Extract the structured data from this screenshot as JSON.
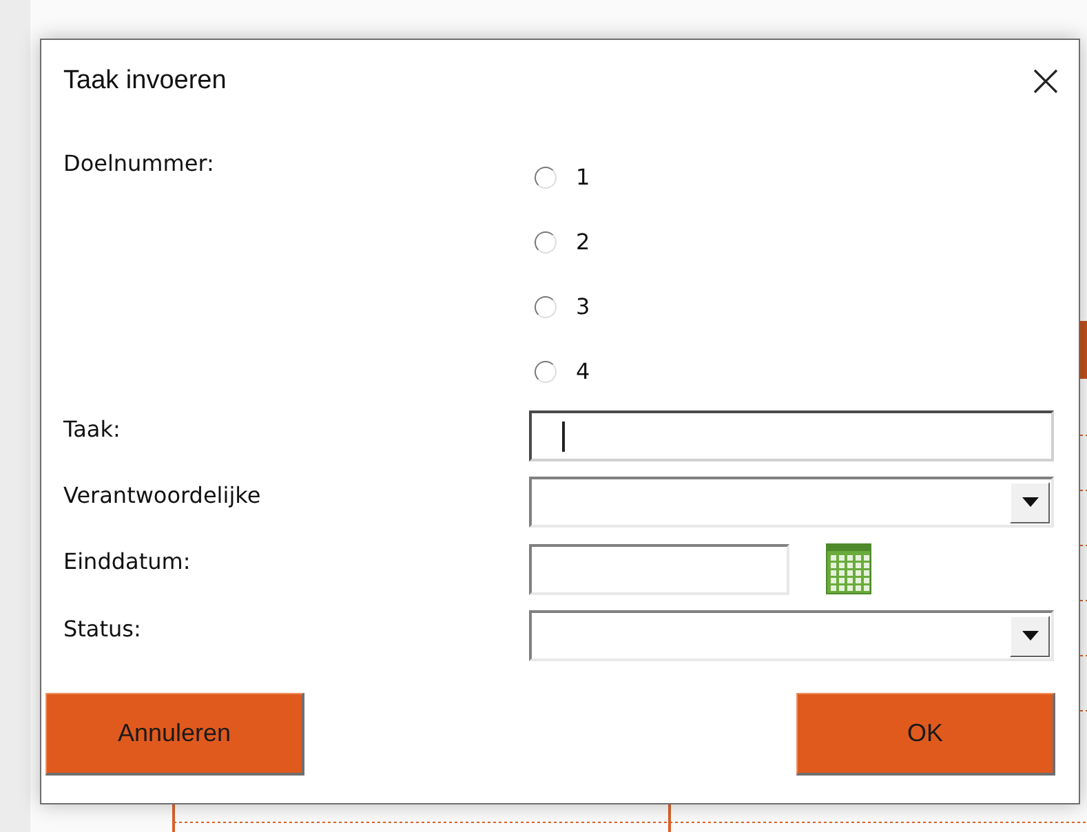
{
  "window": {
    "title": "Taak invoeren"
  },
  "goal_number": {
    "label": "Doelnummer:",
    "options": [
      {
        "label": "1",
        "selected": false
      },
      {
        "label": "2",
        "selected": false
      },
      {
        "label": "3",
        "selected": false
      },
      {
        "label": "4",
        "selected": false
      }
    ]
  },
  "fields": [
    {
      "label": "Taak:",
      "kind": "text",
      "focused": true
    },
    {
      "label": "Verantwoordelijke",
      "kind": "dropdown",
      "focused": false
    },
    {
      "label": "Einddatum:",
      "kind": "date",
      "focused": false
    },
    {
      "label": "Status:",
      "kind": "dropdown",
      "focused": false
    }
  ],
  "buttons": [
    {
      "label": "Annuleren"
    },
    {
      "label": "OK"
    }
  ]
}
